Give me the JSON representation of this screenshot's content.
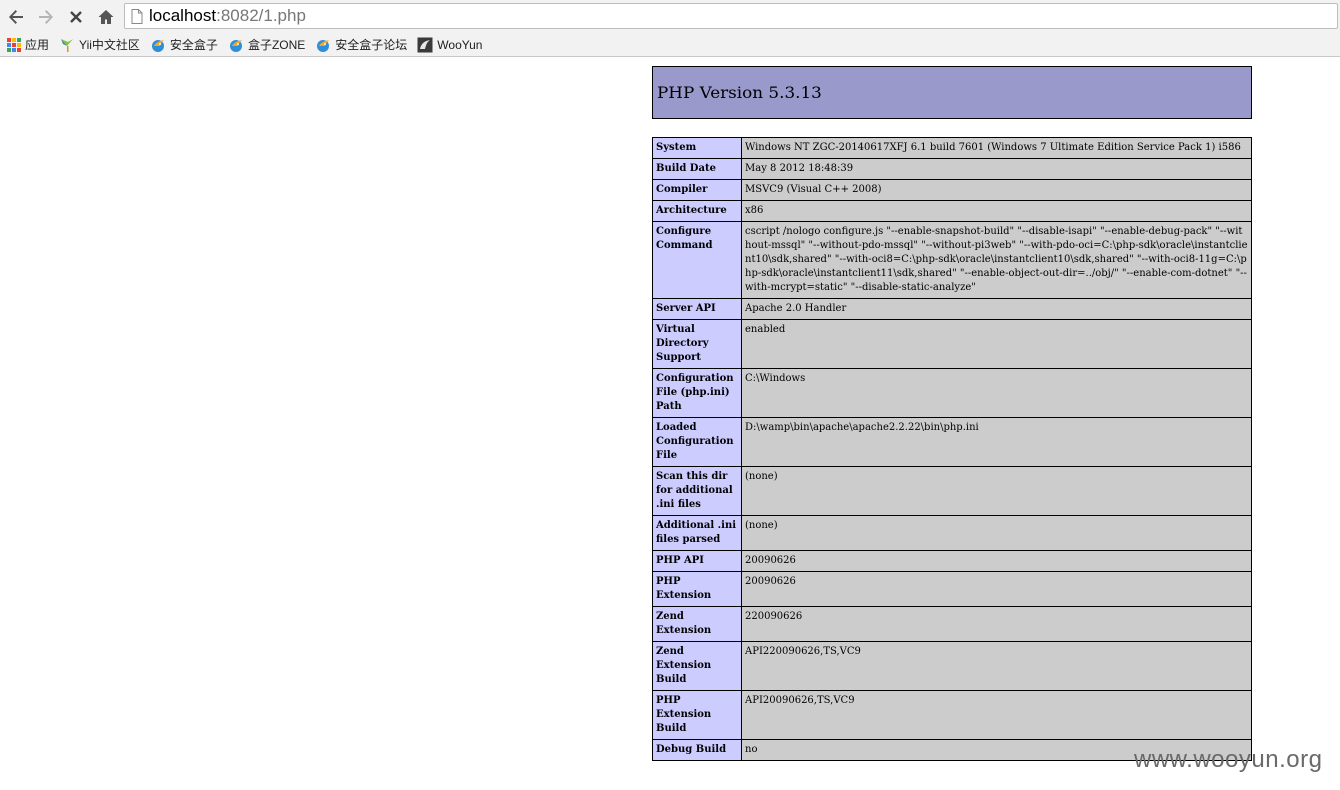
{
  "browser": {
    "url_host": "localhost",
    "url_rest": ":8082/1.php",
    "bookmarks": [
      {
        "label": "应用",
        "icon": "apps-grid-icon"
      },
      {
        "label": "Yii中文社区",
        "icon": "yii-logo-icon"
      },
      {
        "label": "安全盒子",
        "icon": "bird-logo-icon"
      },
      {
        "label": "盒子ZONE",
        "icon": "bird-logo-icon"
      },
      {
        "label": "安全盒子论坛",
        "icon": "bird-logo-icon"
      },
      {
        "label": "WooYun",
        "icon": "wooyun-logo-icon"
      }
    ]
  },
  "colors": {
    "header_bg": "#9999cc",
    "key_cell_bg": "#ccccff",
    "value_cell_bg": "#cccccc"
  },
  "phpinfo": {
    "title": "PHP Version 5.3.13",
    "rows": [
      {
        "key": "System",
        "value": "Windows NT ZGC-20140617XFJ 6.1 build 7601 (Windows 7 Ultimate Edition Service Pack 1) i586"
      },
      {
        "key": "Build Date",
        "value": "May 8 2012 18:48:39"
      },
      {
        "key": "Compiler",
        "value": "MSVC9 (Visual C++ 2008)"
      },
      {
        "key": "Architecture",
        "value": "x86"
      },
      {
        "key": "Configure Command",
        "value": "cscript /nologo configure.js \"--enable-snapshot-build\" \"--disable-isapi\" \"--enable-debug-pack\" \"--without-mssql\" \"--without-pdo-mssql\" \"--without-pi3web\" \"--with-pdo-oci=C:\\php-sdk\\oracle\\instantclient10\\sdk,shared\" \"--with-oci8=C:\\php-sdk\\oracle\\instantclient10\\sdk,shared\" \"--with-oci8-11g=C:\\php-sdk\\oracle\\instantclient11\\sdk,shared\" \"--enable-object-out-dir=../obj/\" \"--enable-com-dotnet\" \"--with-mcrypt=static\" \"--disable-static-analyze\""
      },
      {
        "key": "Server API",
        "value": "Apache 2.0 Handler"
      },
      {
        "key": "Virtual Directory Support",
        "value": "enabled"
      },
      {
        "key": "Configuration File (php.ini) Path",
        "value": "C:\\Windows"
      },
      {
        "key": "Loaded Configuration File",
        "value": "D:\\wamp\\bin\\apache\\apache2.2.22\\bin\\php.ini"
      },
      {
        "key": "Scan this dir for additional .ini files",
        "value": "(none)"
      },
      {
        "key": "Additional .ini files parsed",
        "value": "(none)"
      },
      {
        "key": "PHP API",
        "value": "20090626"
      },
      {
        "key": "PHP Extension",
        "value": "20090626"
      },
      {
        "key": "Zend Extension",
        "value": "220090626"
      },
      {
        "key": "Zend Extension Build",
        "value": "API220090626,TS,VC9"
      },
      {
        "key": "PHP Extension Build",
        "value": "API20090626,TS,VC9"
      },
      {
        "key": "Debug Build",
        "value": "no"
      }
    ]
  },
  "watermark": "www.wooyun.org"
}
